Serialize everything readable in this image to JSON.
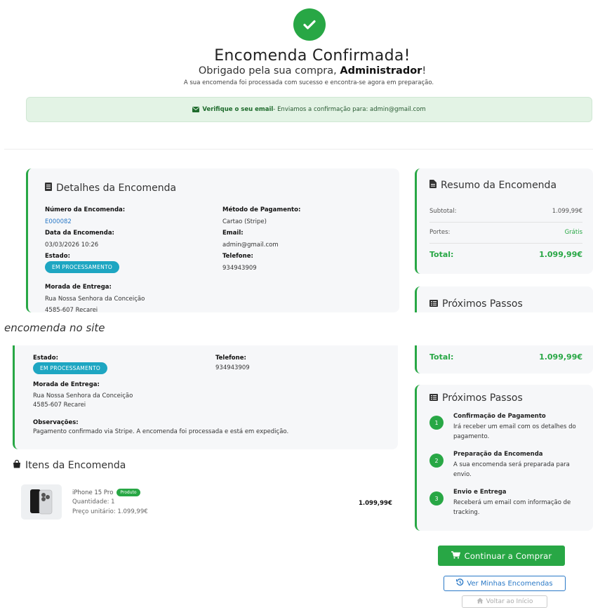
{
  "header": {
    "title": "Encomenda Confirmada!",
    "thanks_prefix": "Obrigado pela sua compra, ",
    "user_name": "Administrador",
    "thanks_suffix": "!",
    "description": "A sua encomenda foi processada com sucesso e encontra-se agora em preparação."
  },
  "alert": {
    "strong": "Verifique o seu email",
    "text": " - Enviamos a confirmação para: admin@gmail.com"
  },
  "details": {
    "title": "Detalhes da Encomenda",
    "order_number_label": "Número da Encomenda:",
    "order_number": "E000082",
    "order_date_label": "Data da Encomenda:",
    "order_date": "03/03/2026 10:26",
    "status_label": "Estado:",
    "status": "EM PROCESSAMENTO",
    "address_label": "Morada de Entrega:",
    "address_line1": "Rua Nossa Senhora da Conceição",
    "address_line2": "4585-607 Recarei",
    "address_line2_cut": "4585-607 Recarei",
    "payment_label": "Método de Pagamento:",
    "payment": "Cartao (Stripe)",
    "email_label": "Email:",
    "email": "admin@gmail.com",
    "phone_label": "Telefone:",
    "phone": "934943909",
    "notes_label": "Observações:",
    "notes": "Pagamento confirmado via Stripe. A encomenda foi processada e está em expedição."
  },
  "summary": {
    "title": "Resumo da Encomenda",
    "subtotal_label": "Subtotal:",
    "subtotal": "1.099,99€",
    "shipping_label": "Portes:",
    "shipping": "Grátis",
    "total_label": "Total:",
    "total": "1.099,99€"
  },
  "next_steps": {
    "title": "Próximos Passos",
    "steps": [
      {
        "num": "1",
        "title": "Confirmação de Pagamento",
        "line1": "Irá receber um email com os detalhes do",
        "line2": "pagamento."
      },
      {
        "num": "2",
        "title": "Preparação da Encomenda",
        "line1": "A sua encomenda será preparada para",
        "line2": "envio."
      },
      {
        "num": "3",
        "title": "Envio e Entrega",
        "line1": "Receberá um email com informação de",
        "line2": "tracking."
      }
    ]
  },
  "caption": "encomenda no site",
  "items": {
    "title": "Itens da Encomenda",
    "list": [
      {
        "name": "iPhone 15 Pro",
        "badge": "Produto",
        "qty": "Quantidade: 1",
        "unit_price": "Preço unitário: 1.099,99€",
        "total": "1.099,99€"
      }
    ]
  },
  "buttons": {
    "continue": "Continuar a Comprar",
    "orders": "Ver Minhas Encomendas",
    "home": "Voltar ao Início"
  },
  "colors": {
    "success": "#28a745",
    "info": "#1ea6c2",
    "link": "#2a79c7"
  }
}
